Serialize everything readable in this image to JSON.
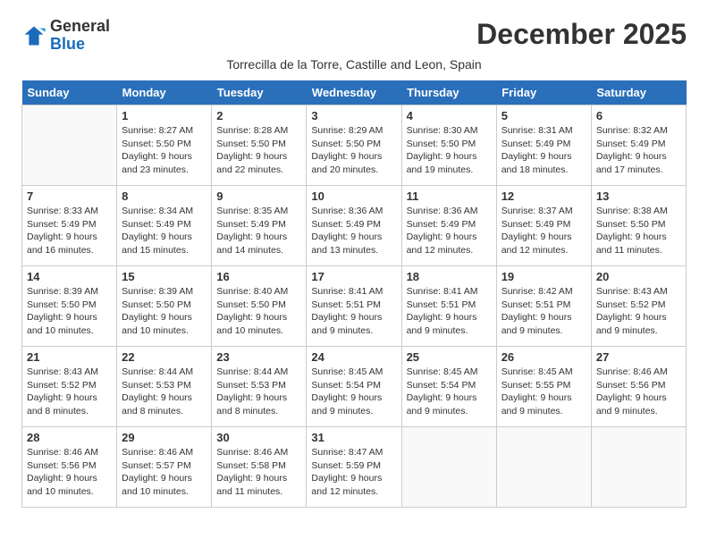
{
  "logo": {
    "general": "General",
    "blue": "Blue"
  },
  "title": "December 2025",
  "subtitle": "Torrecilla de la Torre, Castille and Leon, Spain",
  "days_header": [
    "Sunday",
    "Monday",
    "Tuesday",
    "Wednesday",
    "Thursday",
    "Friday",
    "Saturday"
  ],
  "weeks": [
    [
      {
        "day": "",
        "info": ""
      },
      {
        "day": "1",
        "info": "Sunrise: 8:27 AM\nSunset: 5:50 PM\nDaylight: 9 hours\nand 23 minutes."
      },
      {
        "day": "2",
        "info": "Sunrise: 8:28 AM\nSunset: 5:50 PM\nDaylight: 9 hours\nand 22 minutes."
      },
      {
        "day": "3",
        "info": "Sunrise: 8:29 AM\nSunset: 5:50 PM\nDaylight: 9 hours\nand 20 minutes."
      },
      {
        "day": "4",
        "info": "Sunrise: 8:30 AM\nSunset: 5:50 PM\nDaylight: 9 hours\nand 19 minutes."
      },
      {
        "day": "5",
        "info": "Sunrise: 8:31 AM\nSunset: 5:49 PM\nDaylight: 9 hours\nand 18 minutes."
      },
      {
        "day": "6",
        "info": "Sunrise: 8:32 AM\nSunset: 5:49 PM\nDaylight: 9 hours\nand 17 minutes."
      }
    ],
    [
      {
        "day": "7",
        "info": "Sunrise: 8:33 AM\nSunset: 5:49 PM\nDaylight: 9 hours\nand 16 minutes."
      },
      {
        "day": "8",
        "info": "Sunrise: 8:34 AM\nSunset: 5:49 PM\nDaylight: 9 hours\nand 15 minutes."
      },
      {
        "day": "9",
        "info": "Sunrise: 8:35 AM\nSunset: 5:49 PM\nDaylight: 9 hours\nand 14 minutes."
      },
      {
        "day": "10",
        "info": "Sunrise: 8:36 AM\nSunset: 5:49 PM\nDaylight: 9 hours\nand 13 minutes."
      },
      {
        "day": "11",
        "info": "Sunrise: 8:36 AM\nSunset: 5:49 PM\nDaylight: 9 hours\nand 12 minutes."
      },
      {
        "day": "12",
        "info": "Sunrise: 8:37 AM\nSunset: 5:49 PM\nDaylight: 9 hours\nand 12 minutes."
      },
      {
        "day": "13",
        "info": "Sunrise: 8:38 AM\nSunset: 5:50 PM\nDaylight: 9 hours\nand 11 minutes."
      }
    ],
    [
      {
        "day": "14",
        "info": "Sunrise: 8:39 AM\nSunset: 5:50 PM\nDaylight: 9 hours\nand 10 minutes."
      },
      {
        "day": "15",
        "info": "Sunrise: 8:39 AM\nSunset: 5:50 PM\nDaylight: 9 hours\nand 10 minutes."
      },
      {
        "day": "16",
        "info": "Sunrise: 8:40 AM\nSunset: 5:50 PM\nDaylight: 9 hours\nand 10 minutes."
      },
      {
        "day": "17",
        "info": "Sunrise: 8:41 AM\nSunset: 5:51 PM\nDaylight: 9 hours\nand 9 minutes."
      },
      {
        "day": "18",
        "info": "Sunrise: 8:41 AM\nSunset: 5:51 PM\nDaylight: 9 hours\nand 9 minutes."
      },
      {
        "day": "19",
        "info": "Sunrise: 8:42 AM\nSunset: 5:51 PM\nDaylight: 9 hours\nand 9 minutes."
      },
      {
        "day": "20",
        "info": "Sunrise: 8:43 AM\nSunset: 5:52 PM\nDaylight: 9 hours\nand 9 minutes."
      }
    ],
    [
      {
        "day": "21",
        "info": "Sunrise: 8:43 AM\nSunset: 5:52 PM\nDaylight: 9 hours\nand 8 minutes."
      },
      {
        "day": "22",
        "info": "Sunrise: 8:44 AM\nSunset: 5:53 PM\nDaylight: 9 hours\nand 8 minutes."
      },
      {
        "day": "23",
        "info": "Sunrise: 8:44 AM\nSunset: 5:53 PM\nDaylight: 9 hours\nand 8 minutes."
      },
      {
        "day": "24",
        "info": "Sunrise: 8:45 AM\nSunset: 5:54 PM\nDaylight: 9 hours\nand 9 minutes."
      },
      {
        "day": "25",
        "info": "Sunrise: 8:45 AM\nSunset: 5:54 PM\nDaylight: 9 hours\nand 9 minutes."
      },
      {
        "day": "26",
        "info": "Sunrise: 8:45 AM\nSunset: 5:55 PM\nDaylight: 9 hours\nand 9 minutes."
      },
      {
        "day": "27",
        "info": "Sunrise: 8:46 AM\nSunset: 5:56 PM\nDaylight: 9 hours\nand 9 minutes."
      }
    ],
    [
      {
        "day": "28",
        "info": "Sunrise: 8:46 AM\nSunset: 5:56 PM\nDaylight: 9 hours\nand 10 minutes."
      },
      {
        "day": "29",
        "info": "Sunrise: 8:46 AM\nSunset: 5:57 PM\nDaylight: 9 hours\nand 10 minutes."
      },
      {
        "day": "30",
        "info": "Sunrise: 8:46 AM\nSunset: 5:58 PM\nDaylight: 9 hours\nand 11 minutes."
      },
      {
        "day": "31",
        "info": "Sunrise: 8:47 AM\nSunset: 5:59 PM\nDaylight: 9 hours\nand 12 minutes."
      },
      {
        "day": "",
        "info": ""
      },
      {
        "day": "",
        "info": ""
      },
      {
        "day": "",
        "info": ""
      }
    ]
  ]
}
